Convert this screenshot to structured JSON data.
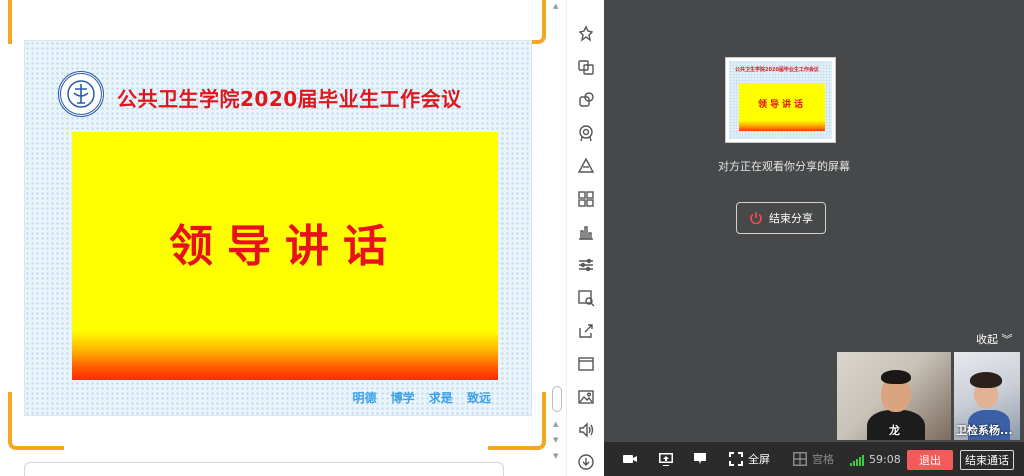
{
  "slide": {
    "title": "公共卫生学院2020届毕业生工作会议",
    "heading": "领导讲话",
    "motto": "明德 博学 求是 致远",
    "logo_icon": "university-seal-icon"
  },
  "preview": {
    "title": "公共卫生学院2020届毕业生工作会议",
    "heading": "领导讲话"
  },
  "meeting": {
    "watching_text": "对方正在观看你分享的屏幕",
    "end_share_label": "结束分享",
    "collapse_label": "收起",
    "participants": [
      {
        "name": "龙"
      },
      {
        "name": "卫检系杨..."
      }
    ],
    "controls": {
      "fullscreen_label": "全屏",
      "gallery_label": "宫格",
      "duration": "59:08",
      "exit_label": "退出",
      "end_call_label": "结束通话"
    }
  },
  "tools": [
    "pin-icon",
    "copy-icon",
    "lasso-icon",
    "badge-icon",
    "shapes-icon",
    "grid-icon",
    "chart-icon",
    "settings-sliders-icon",
    "image-search-icon",
    "export-icon",
    "frame-icon",
    "picture-icon",
    "volume-icon",
    "download-icon"
  ],
  "colors": {
    "accent_orange": "#f5a623",
    "title_red": "#e0161d",
    "slide_yellow": "#ffff00",
    "meeting_bg": "#46484a",
    "exit_red": "#f55a5a"
  }
}
